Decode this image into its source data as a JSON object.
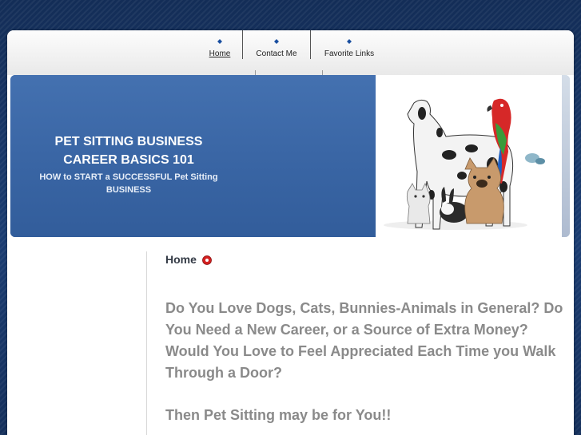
{
  "nav": {
    "items": [
      {
        "label": "Home",
        "active": true
      },
      {
        "label": "Contact Me",
        "active": false
      },
      {
        "label": "Favorite Links",
        "active": false
      }
    ]
  },
  "banner": {
    "title": "PET SITTING BUSINESS CAREER BASICS 101",
    "subtitle": "HOW to START a SUCCESSFUL Pet Sitting BUSINESS",
    "image_alt": "dog, parrot, kitten, rabbit and french bulldog group"
  },
  "breadcrumb": {
    "label": "Home",
    "icon": "rss-icon"
  },
  "content": {
    "paragraph1": "Do You Love Dogs, Cats, Bunnies-Animals in General?  Do You Need a New Career, or a Source of Extra Money?  Would You Love to Feel Appreciated Each Time you Walk Through a Door?",
    "paragraph2": "Then Pet Sitting may be for You!!"
  },
  "colors": {
    "background": "#143260",
    "banner": "#3b68a8",
    "text_gray": "#8a8a8a",
    "bullet_blue": "#1a4fa0"
  }
}
